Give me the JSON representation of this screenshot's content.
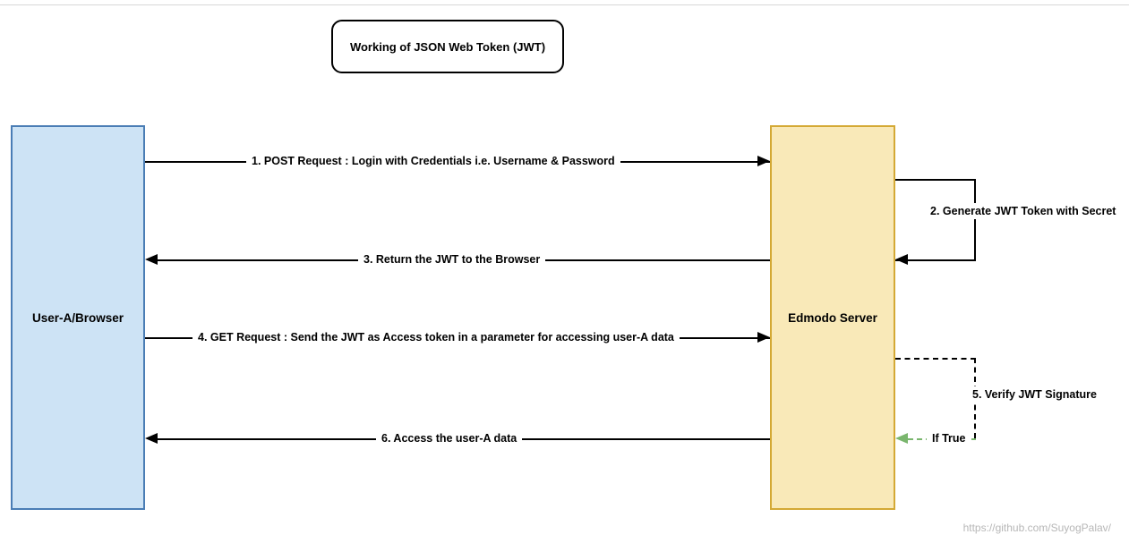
{
  "title": "Working of JSON Web Token (JWT)",
  "actors": {
    "left": "User-A/Browser",
    "right": "Edmodo Server"
  },
  "messages": {
    "m1": "1. POST Request : Login with Credentials i.e. Username & Password",
    "m2": "2. Generate JWT Token with Secret",
    "m3": "3. Return the JWT to the Browser",
    "m4": "4. GET Request : Send the JWT as Access token in a parameter  for accessing user-A data",
    "m5": "5. Verify JWT Signature",
    "m6": "6. Access the user-A data",
    "if_true": "If True"
  },
  "footer": "https://github.com/SuyogPalav/"
}
